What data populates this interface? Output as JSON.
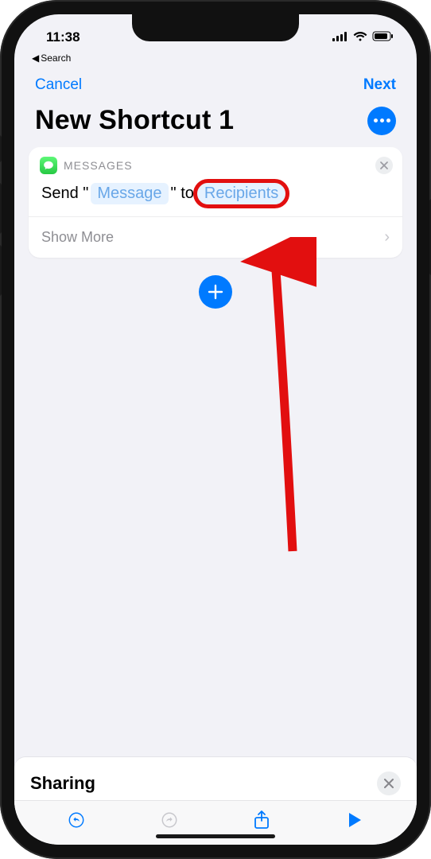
{
  "status": {
    "time": "11:38",
    "back_label": "Search"
  },
  "nav": {
    "cancel": "Cancel",
    "next": "Next"
  },
  "header": {
    "title": "New Shortcut 1"
  },
  "action_card": {
    "app_name": "MESSAGES",
    "send_prefix": "Send \"",
    "message_token": "Message",
    "send_mid": "\" to",
    "recipients_token": "Recipients",
    "show_more": "Show More"
  },
  "panel": {
    "title": "Sharing"
  }
}
